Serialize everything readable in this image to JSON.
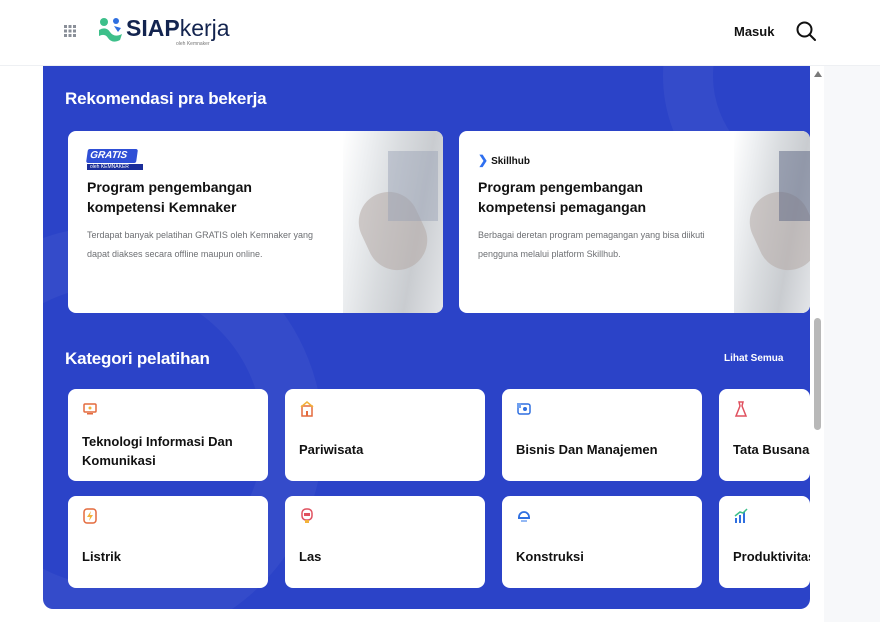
{
  "header": {
    "logo_text_bold": "SIAP",
    "logo_text_regular": "kerja",
    "logo_sub": "oleh Kemnaker",
    "login_label": "Masuk",
    "menu_icon": "grid-icon",
    "search_icon": "search-icon"
  },
  "recommendation": {
    "title": "Rekomendasi pra bekerja",
    "cards": [
      {
        "badge": "GRATIS",
        "badge_sub": "oleh KEMNAKER",
        "title": "Program pengembangan kompetensi Kemnaker",
        "description": "Terdapat banyak pelatihan GRATIS oleh Kemnaker yang dapat diakses secara offline maupun online."
      },
      {
        "badge": "Skillhub",
        "title": "Program pengembangan kompetensi pemagangan",
        "description": "Berbagai deretan program pemagangan yang bisa diikuti pengguna melalui platform Skillhub."
      }
    ]
  },
  "categories": {
    "title": "Kategori pelatihan",
    "see_all": "Lihat Semua",
    "items": [
      {
        "name": "Teknologi Informasi Dan Komunikasi",
        "icon": "computer-icon"
      },
      {
        "name": "Pariwisata",
        "icon": "building-icon"
      },
      {
        "name": "Bisnis Dan Manajemen",
        "icon": "business-icon"
      },
      {
        "name": "Tata Busana",
        "icon": "dress-icon"
      },
      {
        "name": "Listrik",
        "icon": "lightning-icon"
      },
      {
        "name": "Las",
        "icon": "welding-icon"
      },
      {
        "name": "Konstruksi",
        "icon": "construction-icon"
      },
      {
        "name": "Produktivitas",
        "icon": "chart-icon"
      }
    ]
  },
  "colors": {
    "primary": "#2b43c8",
    "brand_green": "#3dbf8a",
    "brand_navy": "#13244f"
  }
}
